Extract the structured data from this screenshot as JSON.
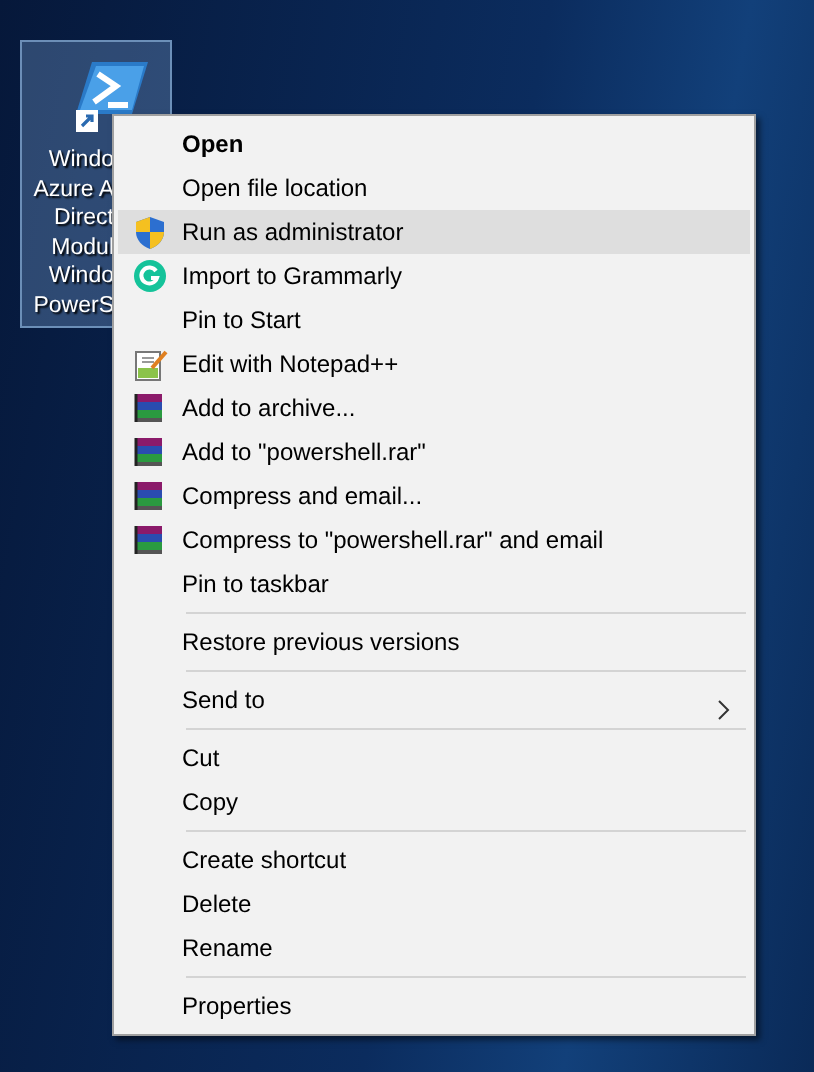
{
  "desktop_icon": {
    "label_lines": [
      "Windo",
      "Azure A",
      "Direct",
      "Modul",
      "Windo",
      "PowerS"
    ],
    "selected": true
  },
  "context_menu": {
    "items": [
      {
        "kind": "plain",
        "label": "Open",
        "default": true,
        "selected": false
      },
      {
        "kind": "plain",
        "label": "Open file location",
        "selected": false
      },
      {
        "kind": "shield",
        "label": "Run as administrator",
        "selected": true
      },
      {
        "kind": "grammarly",
        "label": "Import to Grammarly",
        "selected": false
      },
      {
        "kind": "plain",
        "label": "Pin to Start",
        "selected": false
      },
      {
        "kind": "notepad",
        "label": "Edit with Notepad++",
        "selected": false
      },
      {
        "kind": "archive",
        "label": "Add to archive...",
        "selected": false
      },
      {
        "kind": "archive",
        "label": "Add to \"powershell.rar\"",
        "selected": false
      },
      {
        "kind": "archive",
        "label": "Compress and email...",
        "selected": false
      },
      {
        "kind": "archive",
        "label": "Compress to \"powershell.rar\" and email",
        "selected": false
      },
      {
        "kind": "plain",
        "label": "Pin to taskbar",
        "selected": false
      },
      {
        "kind": "separator"
      },
      {
        "kind": "plain",
        "label": "Restore previous versions",
        "selected": false
      },
      {
        "kind": "separator"
      },
      {
        "kind": "plain",
        "label": "Send to",
        "submenu": true,
        "selected": false
      },
      {
        "kind": "separator"
      },
      {
        "kind": "plain",
        "label": "Cut",
        "selected": false
      },
      {
        "kind": "plain",
        "label": "Copy",
        "selected": false
      },
      {
        "kind": "separator"
      },
      {
        "kind": "plain",
        "label": "Create shortcut",
        "selected": false
      },
      {
        "kind": "plain",
        "label": "Delete",
        "selected": false
      },
      {
        "kind": "plain",
        "label": "Rename",
        "selected": false
      },
      {
        "kind": "separator"
      },
      {
        "kind": "plain",
        "label": "Properties",
        "selected": false
      }
    ]
  }
}
